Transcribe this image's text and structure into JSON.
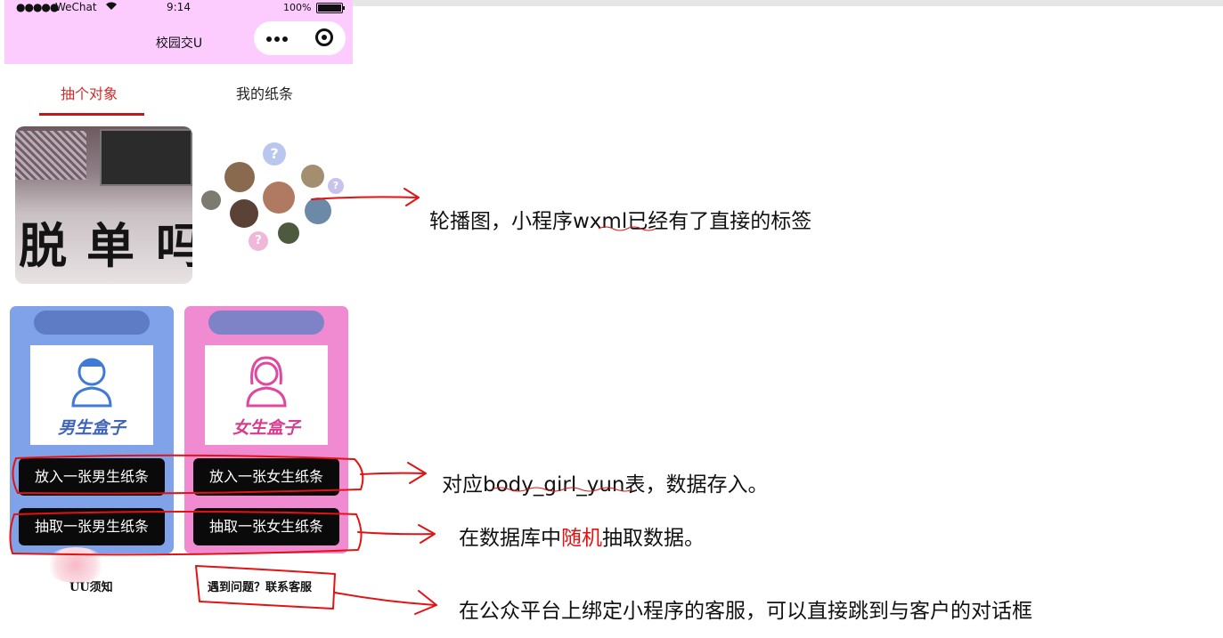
{
  "status_bar": {
    "signal": "●●●●●",
    "carrier": "WeChat",
    "time": "9:14",
    "battery": "100%"
  },
  "header": {
    "title": "校园交U"
  },
  "tabs": [
    {
      "label": "抽个对象",
      "active": true
    },
    {
      "label": "我的纸条",
      "active": false
    }
  ],
  "carousel": {
    "slide1_chars": [
      "脱",
      "单",
      "吗"
    ]
  },
  "cards": {
    "boy": {
      "image_label": "男生盒子",
      "put_button": "放入一张男生纸条",
      "draw_button": "抽取一张男生纸条"
    },
    "girl": {
      "image_label": "女生盒子",
      "put_button": "放入一张女生纸条",
      "draw_button": "抽取一张女生纸条"
    }
  },
  "footer": {
    "notice": "UU须知",
    "contact": "遇到问题？联系客服"
  },
  "annotations": {
    "carousel_note": "轮播图，小程序wxml已经有了直接的标签",
    "put_note": "对应body_girl_yun表，数据存入。",
    "draw_note_before": "在数据库中",
    "draw_note_highlight": "随机",
    "draw_note_after": "抽取数据。",
    "service_note": "在公众平台上绑定小程序的客服，可以直接跳到与客户的对话框"
  },
  "colors": {
    "header_bg": "#fcccff",
    "tab_active": "#d42a2a",
    "boy_card": "#7fa2e8",
    "girl_card": "#f08ad1",
    "ink": "#e31313"
  }
}
